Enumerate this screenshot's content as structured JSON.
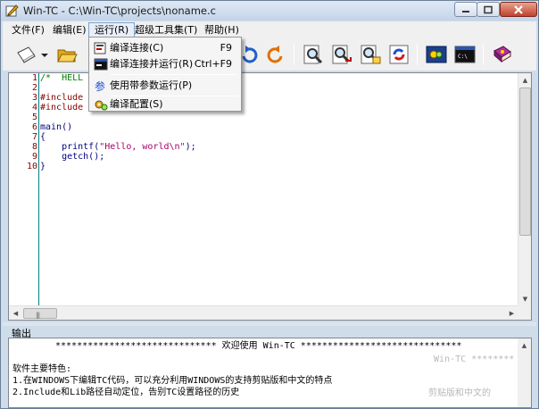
{
  "window": {
    "title": "Win-TC - C:\\Win-TC\\projects\\noname.c"
  },
  "menubar": {
    "items": [
      {
        "label": "文件(F)"
      },
      {
        "label": "编辑(E)"
      },
      {
        "label": "运行(R)"
      },
      {
        "label": "超级工具集(T)"
      },
      {
        "label": "帮助(H)"
      }
    ]
  },
  "run_menu": {
    "items": [
      {
        "label": "编译连接(C)",
        "shortcut": "F9",
        "icon": "compile-link-icon"
      },
      {
        "label": "编译连接并运行(R)",
        "shortcut": "Ctrl+F9",
        "icon": "compile-run-icon"
      },
      {
        "label": "使用带参数运行(P)",
        "shortcut": "",
        "icon": "run-with-params-icon"
      },
      {
        "label": "编译配置(S)",
        "shortcut": "",
        "icon": "compile-config-icon"
      }
    ]
  },
  "toolbar": {
    "buttons": [
      {
        "icon": "new-file-icon"
      },
      {
        "icon": "new-file-dropdown-icon"
      },
      {
        "icon": "open-folder-icon"
      },
      {
        "icon": "undo-icon"
      },
      {
        "icon": "redo-icon"
      },
      {
        "icon": "find-icon"
      },
      {
        "icon": "find-next-icon"
      },
      {
        "icon": "replace-icon"
      },
      {
        "icon": "refresh-icon"
      },
      {
        "icon": "compile-run-toolbar-icon"
      },
      {
        "icon": "console-icon"
      },
      {
        "icon": "help-book-icon"
      }
    ]
  },
  "editor": {
    "line_numbers": [
      "1",
      "2",
      "3",
      "4",
      "5",
      "6",
      "7",
      "8",
      "9",
      "10"
    ],
    "lines": [
      {
        "text": "/*  HELL",
        "kind": "comment"
      },
      {
        "text": "",
        "kind": "plain"
      },
      {
        "text": "#include",
        "kind": "pre"
      },
      {
        "text": "#include",
        "kind": "pre"
      },
      {
        "text": "",
        "kind": "plain"
      },
      {
        "text": "main()",
        "kind": "plain"
      },
      {
        "text": "{",
        "kind": "plain"
      },
      {
        "text": "    printf(\"Hello, world\\n\");",
        "kind": "code"
      },
      {
        "text": "    getch();",
        "kind": "plain"
      },
      {
        "text": "}",
        "kind": "plain"
      }
    ]
  },
  "output": {
    "label": "输出",
    "lines": [
      "****************************** 欢迎使用 Win-TC ******************************",
      "",
      "软件主要特色:",
      "1.在WINDOWS下编辑TC代码，可以充分利用WINDOWS的支持剪贴版和中文的特点",
      "2.Include和Lib路径自动定位，告别TC设置路径的历史"
    ],
    "ghost_text": [
      "Win-TC ********",
      "剪贴版和中文的"
    ]
  },
  "colors": {
    "comment": "#008000",
    "preprocessor": "#880000",
    "string": "#aa0066",
    "code": "#000080"
  }
}
